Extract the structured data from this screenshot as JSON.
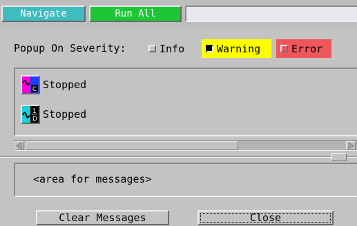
{
  "colors": {
    "navigate_bg": "#3fbcc0",
    "runall_bg": "#1cc635",
    "warning_bg": "#ffff00",
    "error_bg": "#f0565a"
  },
  "toolbar": {
    "navigate_label": "Navigate",
    "run_all_label": "Run All",
    "field_value": ""
  },
  "severity": {
    "label": "Popup On Severity:",
    "options": [
      {
        "label": "Info",
        "checked": false
      },
      {
        "label": "Warning",
        "checked": true
      },
      {
        "label": "Error",
        "checked": false
      }
    ]
  },
  "processes": [
    {
      "status": "Stopped",
      "icon": "signal-source-icon"
    },
    {
      "status": "Stopped",
      "icon": "process-1d-icon"
    }
  ],
  "messages": {
    "placeholder": "<area for messages>"
  },
  "buttons": {
    "clear_messages": "Clear Messages",
    "close": "Close"
  }
}
